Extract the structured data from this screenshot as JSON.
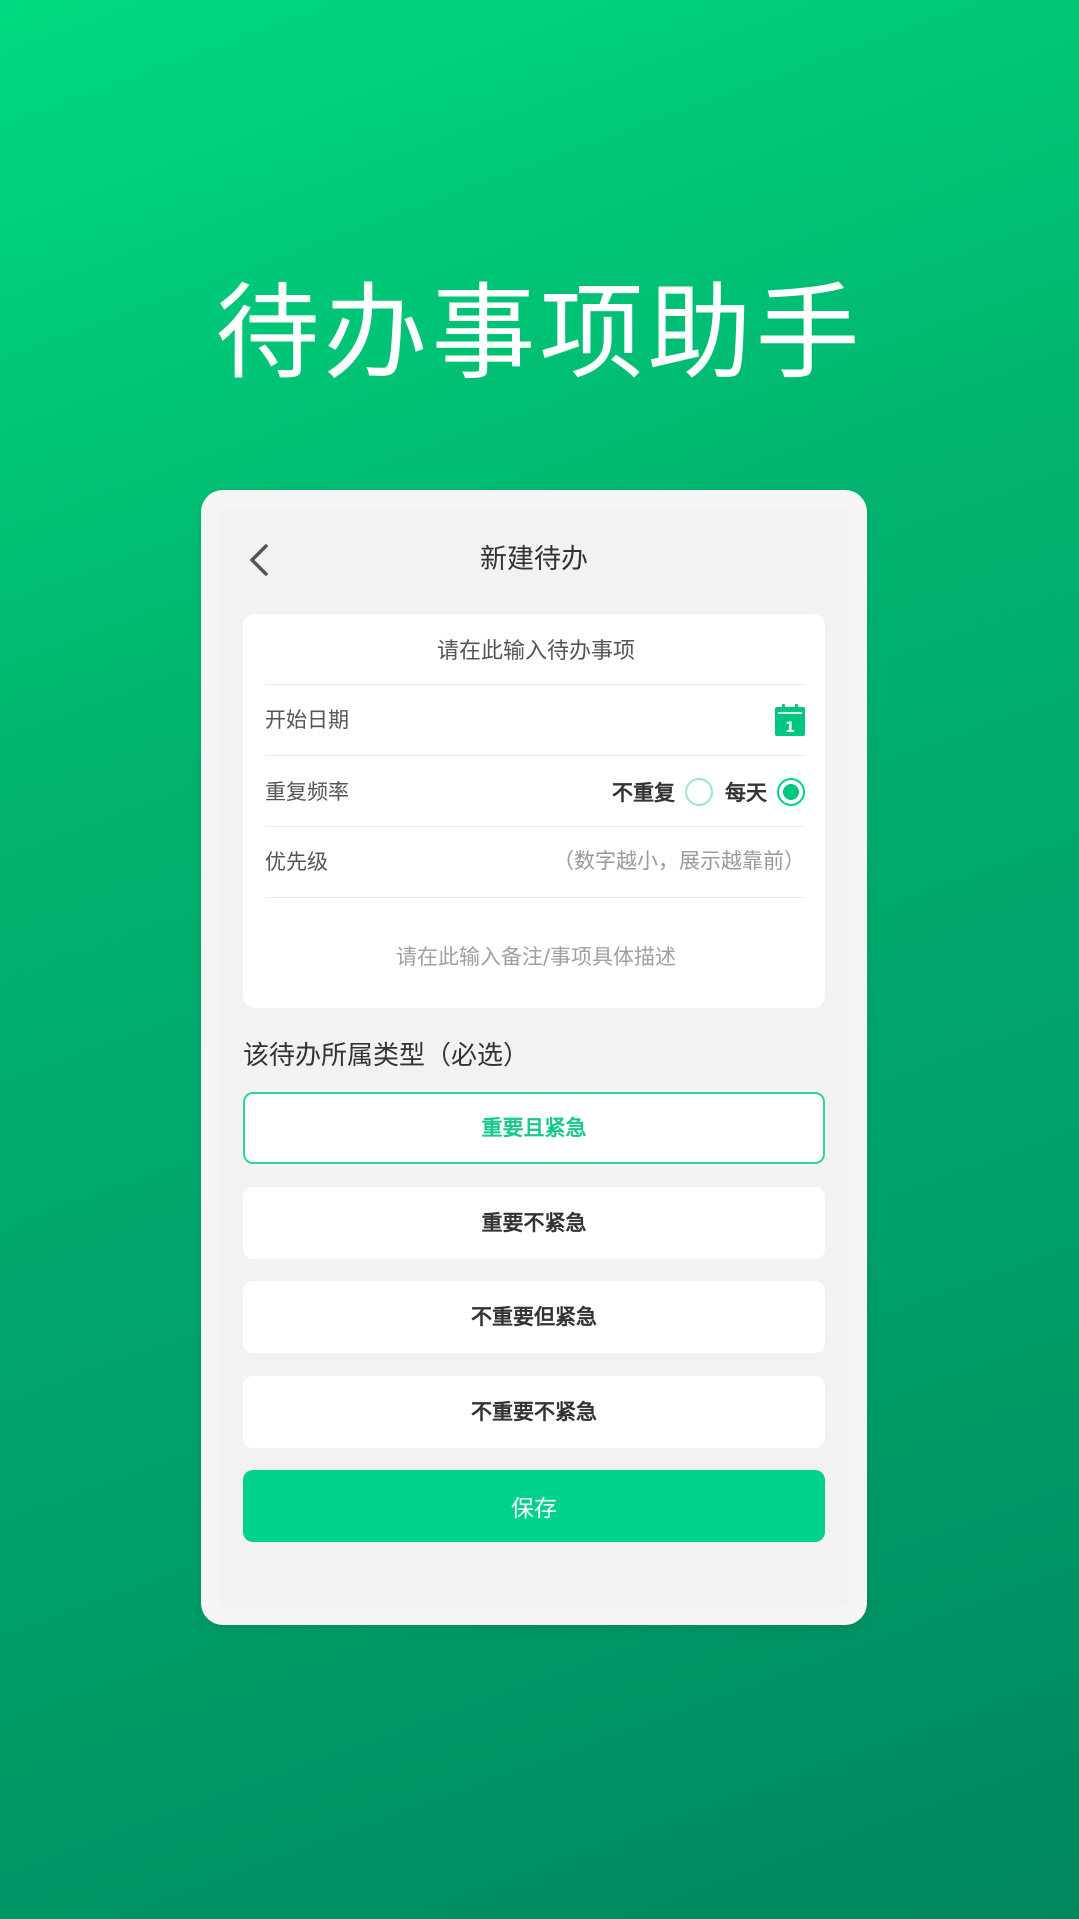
{
  "hero": {
    "title": "待办事项助手"
  },
  "nav": {
    "back_icon": "chevron-left-icon",
    "title": "新建待办"
  },
  "form": {
    "title_placeholder": "请在此输入待办事项",
    "title_value": "",
    "start_date_label": "开始日期",
    "calendar_icon": "calendar-icon",
    "calendar_day": "1",
    "repeat_label": "重复频率",
    "repeat_options": [
      {
        "label": "不重复",
        "selected": false
      },
      {
        "label": "每天",
        "selected": true
      }
    ],
    "priority_label": "优先级",
    "priority_hint": "（数字越小，展示越靠前）",
    "note_placeholder": "请在此输入备注/事项具体描述",
    "note_value": ""
  },
  "category": {
    "section_title": "该待办所属类型（必选）",
    "options": [
      {
        "label": "重要且紧急",
        "selected": true
      },
      {
        "label": "重要不紧急",
        "selected": false
      },
      {
        "label": "不重要但紧急",
        "selected": false
      },
      {
        "label": "不重要不紧急",
        "selected": false
      }
    ]
  },
  "actions": {
    "save_label": "保存"
  },
  "colors": {
    "accent": "#00d18c",
    "selected_text": "#19c98a",
    "background_top": "#00d97f",
    "background_bottom": "#00875f"
  }
}
